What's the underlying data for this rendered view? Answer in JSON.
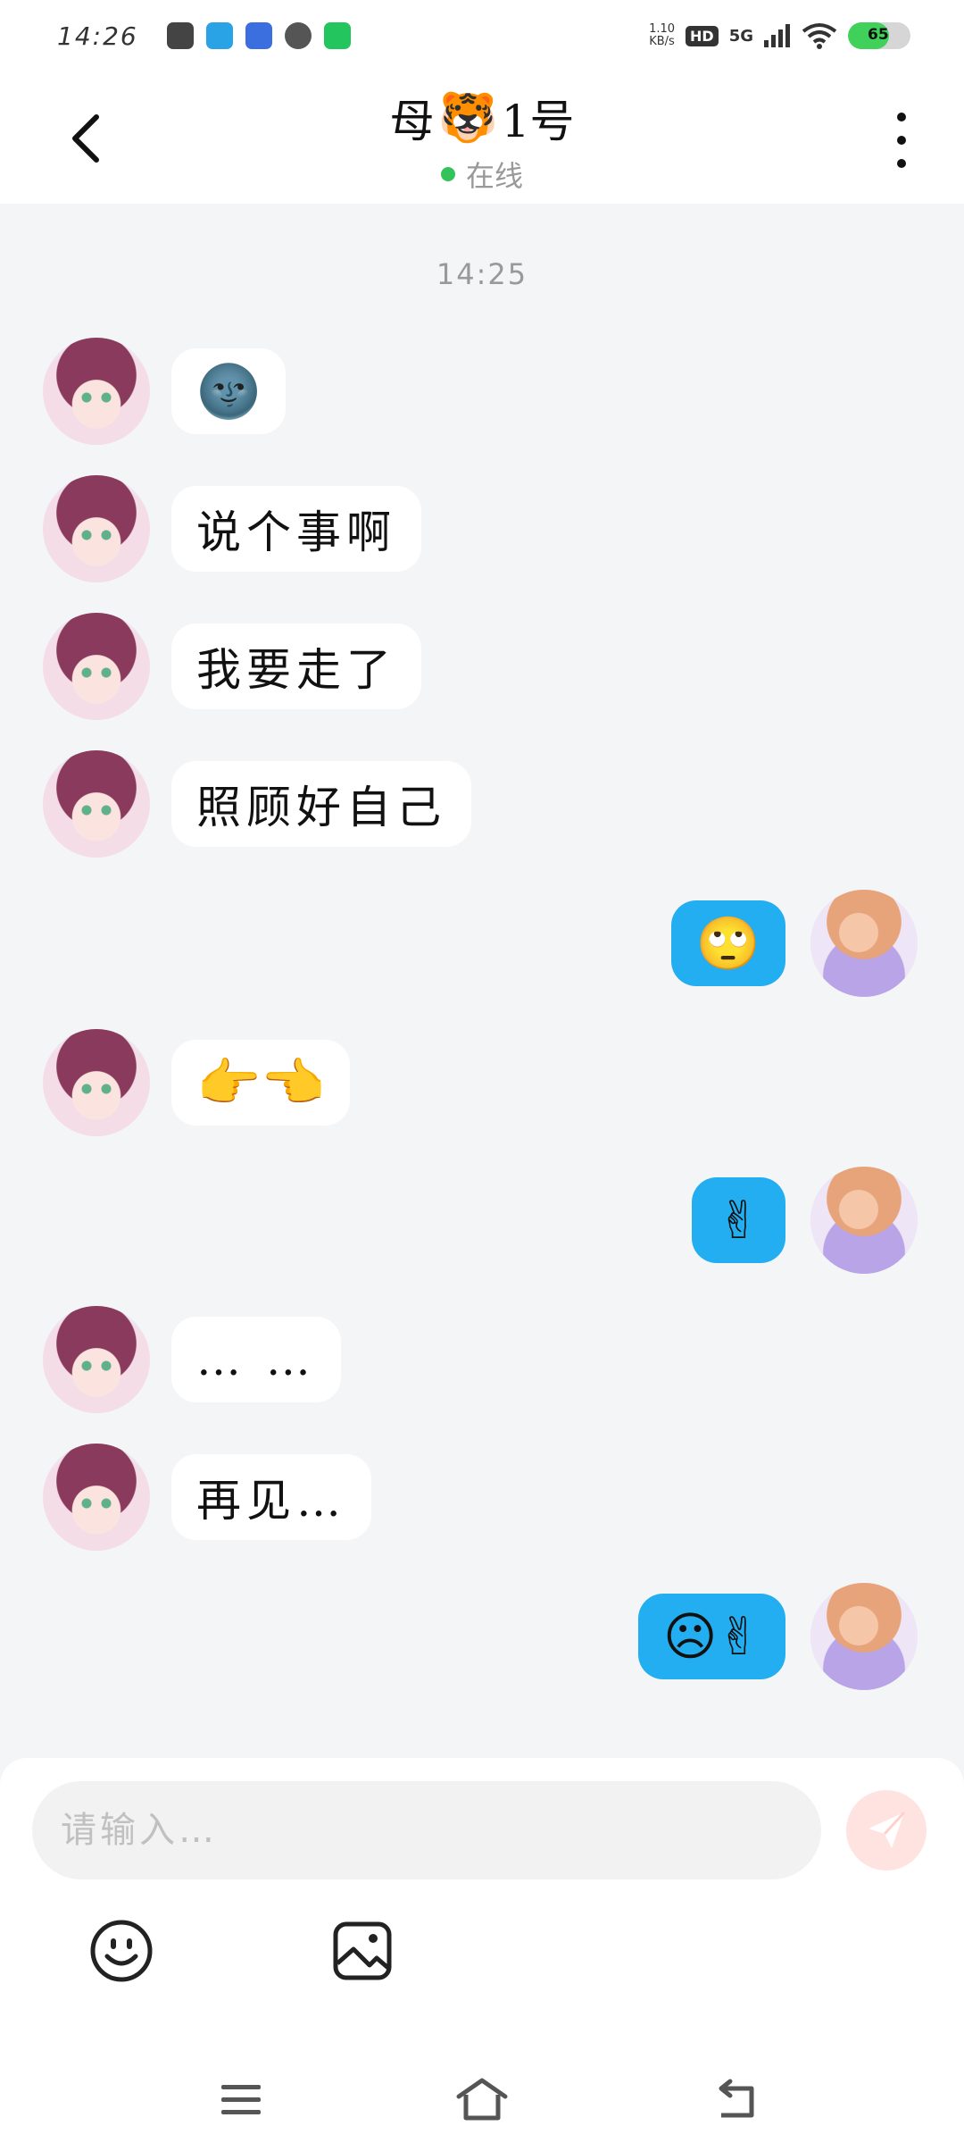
{
  "status_bar": {
    "time": "14:26",
    "net_speed_value": "1.10",
    "net_speed_unit": "KB/s",
    "hd": "HD",
    "network": "5G",
    "battery": "65",
    "battery_level": 0.65
  },
  "header": {
    "title_left": "母",
    "title_emoji": "🐯",
    "title_right": "1号",
    "status": "在线"
  },
  "chat": {
    "timestamp": "14:25",
    "messages": [
      {
        "side": "left",
        "text": "🌚"
      },
      {
        "side": "left",
        "text": "说个事啊"
      },
      {
        "side": "left",
        "text": "我要走了"
      },
      {
        "side": "left",
        "text": "照顾好自己"
      },
      {
        "side": "right",
        "text": "🙄"
      },
      {
        "side": "left",
        "text": "👉👈"
      },
      {
        "side": "right",
        "text": "✌"
      },
      {
        "side": "left",
        "text": "… …"
      },
      {
        "side": "left",
        "text": "再见…"
      },
      {
        "side": "right",
        "text": "☹✌"
      }
    ]
  },
  "composer": {
    "placeholder": "请输入…"
  },
  "colors": {
    "accent": "#22aef0",
    "online": "#34c35a",
    "background": "#f4f5f7"
  }
}
